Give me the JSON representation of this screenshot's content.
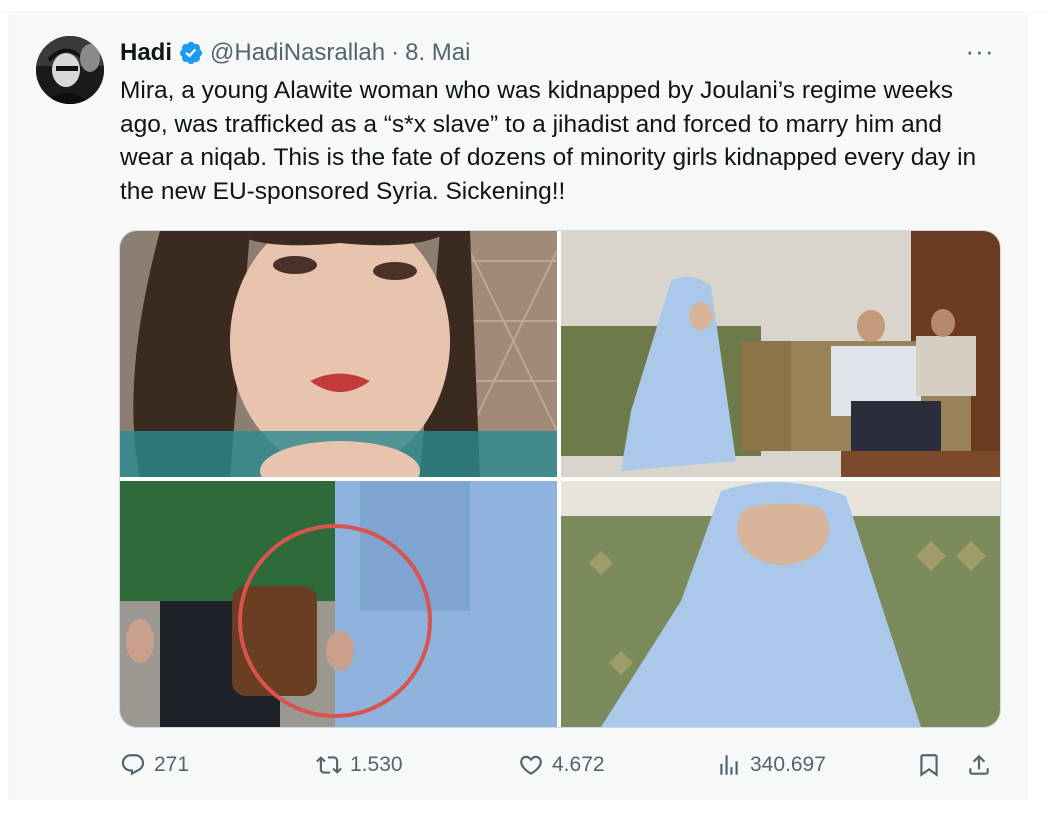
{
  "tweet": {
    "author_name": "Hadi",
    "handle": "@HadiNasrallah",
    "separator": "·",
    "date": "8. Mai",
    "more_label": "···",
    "text": "Mira, a young Alawite woman who was kidnapped by Joulani’s regime weeks ago, was trafficked as a “s*x slave” to a jihadist and forced to marry him and wear a niqab. This is the fate of dozens of minority girls kidnapped every day in the new EU-sponsored Syria. Sickening!!"
  },
  "media": {
    "images": [
      {
        "name": "photo-woman-selfie"
      },
      {
        "name": "photo-veiled-woman-seated-with-men"
      },
      {
        "name": "photo-hands-circled"
      },
      {
        "name": "photo-veiled-woman-closeup"
      }
    ]
  },
  "actions": {
    "replies": "271",
    "reposts": "1.530",
    "likes": "4.672",
    "views": "340.697"
  },
  "colors": {
    "text": "#0f1419",
    "secondary": "#536471",
    "verified": "#1d9bf0",
    "card_bg": "#f7f9f9",
    "highlight_circle": "#d9534f"
  },
  "icons": [
    "verified-badge-icon",
    "more-icon",
    "reply-icon",
    "retweet-icon",
    "like-icon",
    "views-icon",
    "bookmark-icon",
    "share-icon"
  ]
}
